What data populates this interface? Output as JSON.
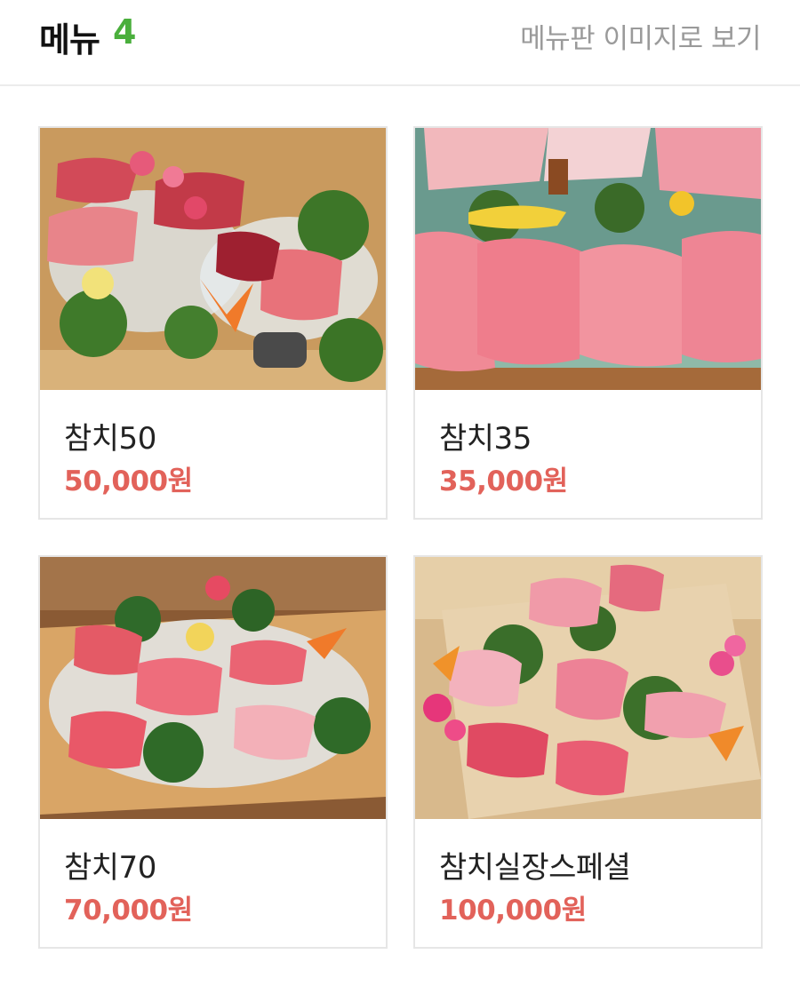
{
  "header": {
    "title": "메뉴",
    "count": "4",
    "board_link": "메뉴판 이미지로 보기"
  },
  "menu": [
    {
      "name": "참치50",
      "price": "50,000원",
      "image": "tuna-sashimi-platter-photo"
    },
    {
      "name": "참치35",
      "price": "35,000원",
      "image": "tuna-sashimi-platter-photo"
    },
    {
      "name": "참치70",
      "price": "70,000원",
      "image": "tuna-sashimi-platter-photo"
    },
    {
      "name": "참치실장스페셜",
      "price": "100,000원",
      "image": "tuna-sashimi-platter-photo"
    }
  ],
  "colors": {
    "count_accent": "#4aaf3c",
    "price": "#e2625a",
    "link_gray": "#9a9a9a"
  }
}
